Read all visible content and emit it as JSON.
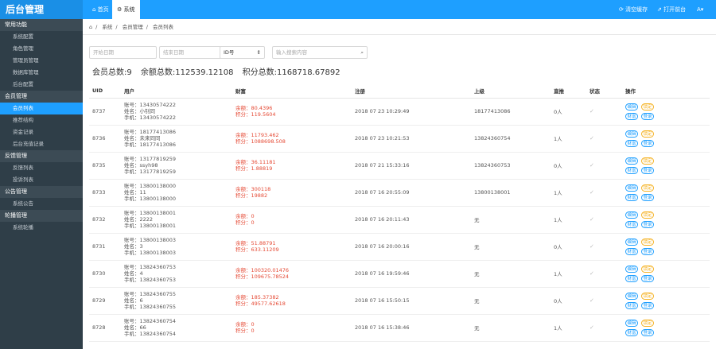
{
  "header": {
    "brand": "后台管理",
    "tabs": [
      "首页",
      "系统"
    ],
    "right_links": [
      "清空缓存",
      "打开前台",
      "A"
    ]
  },
  "sidebar": [
    {
      "group": "常用功能",
      "items": [
        "系统配置",
        "角色管理",
        "管理员管理",
        "数据库管理",
        "后台配置"
      ]
    },
    {
      "group": "会员管理",
      "items": [
        "会员列表",
        "推荐结构",
        "资金记录",
        "后台充值记录"
      ]
    },
    {
      "group": "反馈管理",
      "items": [
        "反馈列表",
        "投诉列表"
      ]
    },
    {
      "group": "公告管理",
      "items": [
        "系统公告"
      ]
    },
    {
      "group": "轮播管理",
      "items": [
        "系统轮播"
      ]
    }
  ],
  "breadcrumb": [
    "系统",
    "会员管理",
    "会员列表"
  ],
  "filters": {
    "start_placeholder": "开始日期",
    "end_placeholder": "结束日期",
    "select_value": "ID号",
    "search_placeholder": "输入搜索内容"
  },
  "stats": {
    "count": "会员总数:9",
    "balance": "余额总数:112539.12108",
    "points": "积分总数:1168718.67892"
  },
  "table": {
    "headers": [
      "UID",
      "用户",
      "财富",
      "注册",
      "上级",
      "直推",
      "状态",
      "操作"
    ],
    "actions": [
      "编辑",
      "锁定",
      "财富",
      "登录"
    ],
    "rows": [
      {
        "uid": "8737",
        "account": "账号：13430574222",
        "name": "姓名：小钊同",
        "phone": "手机：13430574222",
        "bal": "余额：80.4396",
        "pts": "积分：119.5604",
        "reg": "2018 07 23 10:29:49",
        "up": "18177413086",
        "direct": "0人"
      },
      {
        "uid": "8736",
        "account": "账号：18177413086",
        "name": "姓名：未来同同",
        "phone": "手机：18177413086",
        "bal": "余额：11793.462",
        "pts": "积分：1088698.508",
        "reg": "2018 07 23 10:21:53",
        "up": "13824360754",
        "direct": "1人"
      },
      {
        "uid": "8735",
        "account": "账号：13177819259",
        "name": "姓名：ssyh98",
        "phone": "手机：13177819259",
        "bal": "余额：36.11181",
        "pts": "积分：1.88819",
        "reg": "2018 07 21 15:33:16",
        "up": "13824360753",
        "direct": "0人"
      },
      {
        "uid": "8733",
        "account": "账号：13800138000",
        "name": "姓名：11",
        "phone": "手机：13800138000",
        "bal": "余额：300118",
        "pts": "积分：19882",
        "reg": "2018 07 16 20:55:09",
        "up": "13800138001",
        "direct": "1人"
      },
      {
        "uid": "8732",
        "account": "账号：13800138001",
        "name": "姓名：2222",
        "phone": "手机：13800138001",
        "bal": "余额：0",
        "pts": "积分：0",
        "reg": "2018 07 16 20:11:43",
        "up": "无",
        "direct": "1人"
      },
      {
        "uid": "8731",
        "account": "账号：13800138003",
        "name": "姓名：3",
        "phone": "手机：13800138003",
        "bal": "余额：51.88791",
        "pts": "积分：633.11209",
        "reg": "2018 07 16 20:00:16",
        "up": "无",
        "direct": "0人"
      },
      {
        "uid": "8730",
        "account": "账号：13824360753",
        "name": "姓名：4",
        "phone": "手机：13824360753",
        "bal": "余额：100320.01476",
        "pts": "积分：109675.78524",
        "reg": "2018 07 16 19:59:46",
        "up": "无",
        "direct": "1人"
      },
      {
        "uid": "8729",
        "account": "账号：13824360755",
        "name": "姓名：6",
        "phone": "手机：13824360755",
        "bal": "余额：185.37382",
        "pts": "积分：49577.62618",
        "reg": "2018 07 16 15:50:15",
        "up": "无",
        "direct": "0人"
      },
      {
        "uid": "8728",
        "account": "账号：13824360754",
        "name": "姓名：66",
        "phone": "手机：13824360754",
        "bal": "余额：0",
        "pts": "积分：0",
        "reg": "2018 07 16 15:38:46",
        "up": "无",
        "direct": "1人"
      }
    ]
  },
  "colors": {
    "accent": "#1e9fff",
    "sidebar": "#2f3e48",
    "value_red": "#e54a35",
    "warn": "#f5b120"
  },
  "icons": [
    "home-icon",
    "gear-icon",
    "refresh-icon",
    "external-link-icon",
    "user-icon",
    "search-icon",
    "check-icon"
  ]
}
